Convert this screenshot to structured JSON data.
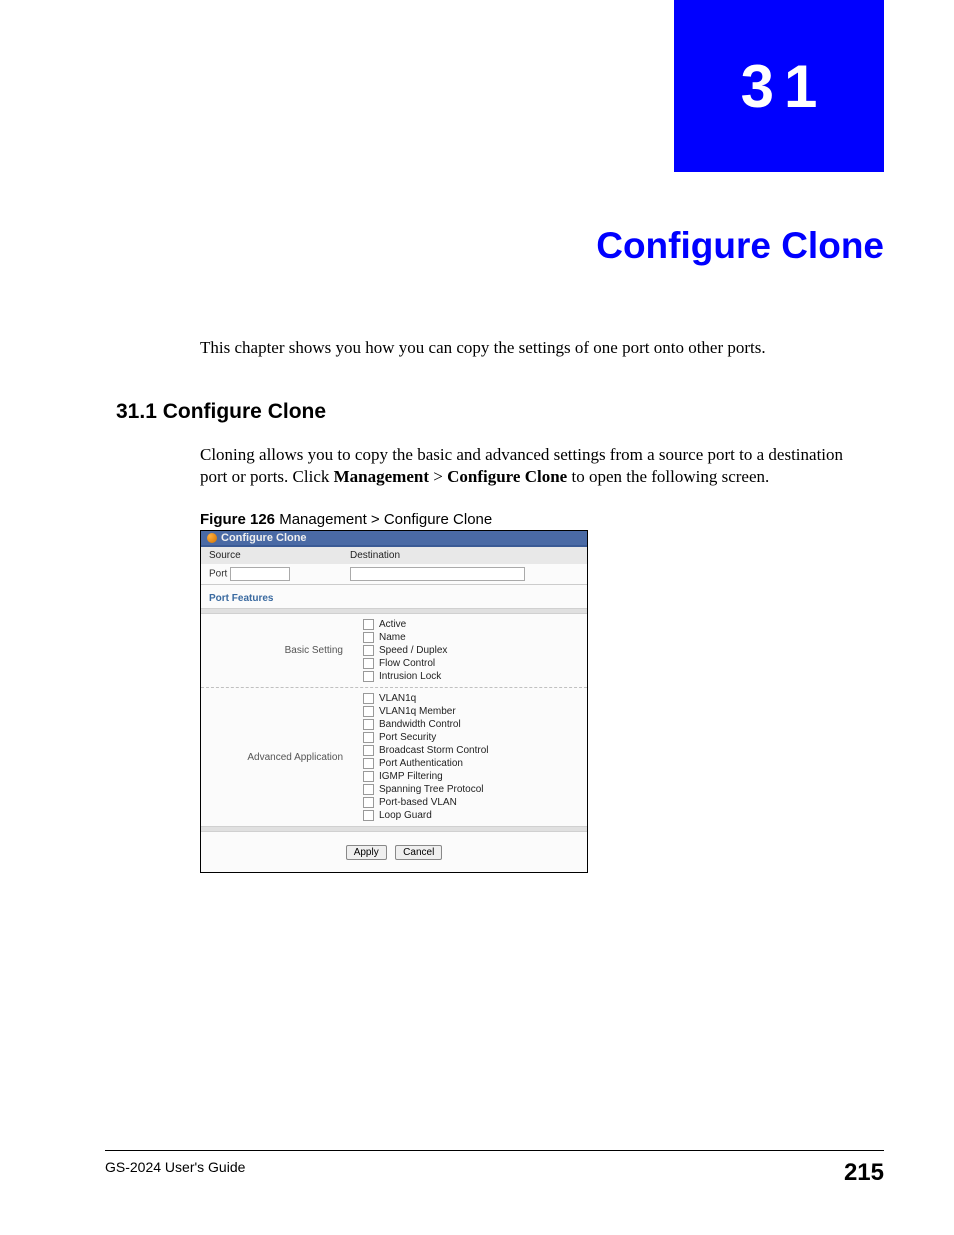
{
  "chapter": {
    "number": "31",
    "title": "Configure Clone",
    "intro": "This chapter shows you how you can copy the settings of one port onto other ports."
  },
  "section": {
    "heading": "31.1  Configure Clone",
    "body_pre": "Cloning allows you to copy the basic and advanced settings from a source port to a destination port or ports. Click ",
    "body_b1": "Management",
    "body_mid": " > ",
    "body_b2": "Configure Clone",
    "body_post": " to open the following screen."
  },
  "figure": {
    "label": "Figure 126",
    "caption": "   Management > Configure Clone"
  },
  "screenshot": {
    "title": "Configure Clone",
    "columns": {
      "source": "Source",
      "destination": "Destination"
    },
    "port_label": "Port",
    "port_features_title": "Port Features",
    "groups": [
      {
        "label": "Basic Setting",
        "items": [
          "Active",
          "Name",
          "Speed / Duplex",
          "Flow Control",
          "Intrusion Lock"
        ]
      },
      {
        "label": "Advanced Application",
        "items": [
          "VLAN1q",
          "VLAN1q Member",
          "Bandwidth Control",
          "Port Security",
          "Broadcast Storm Control",
          "Port Authentication",
          "IGMP Filtering",
          "Spanning Tree Protocol",
          "Port-based VLAN",
          "Loop Guard"
        ]
      }
    ],
    "buttons": {
      "apply": "Apply",
      "cancel": "Cancel"
    }
  },
  "footer": {
    "guide": "GS-2024 User's Guide",
    "page": "215"
  }
}
